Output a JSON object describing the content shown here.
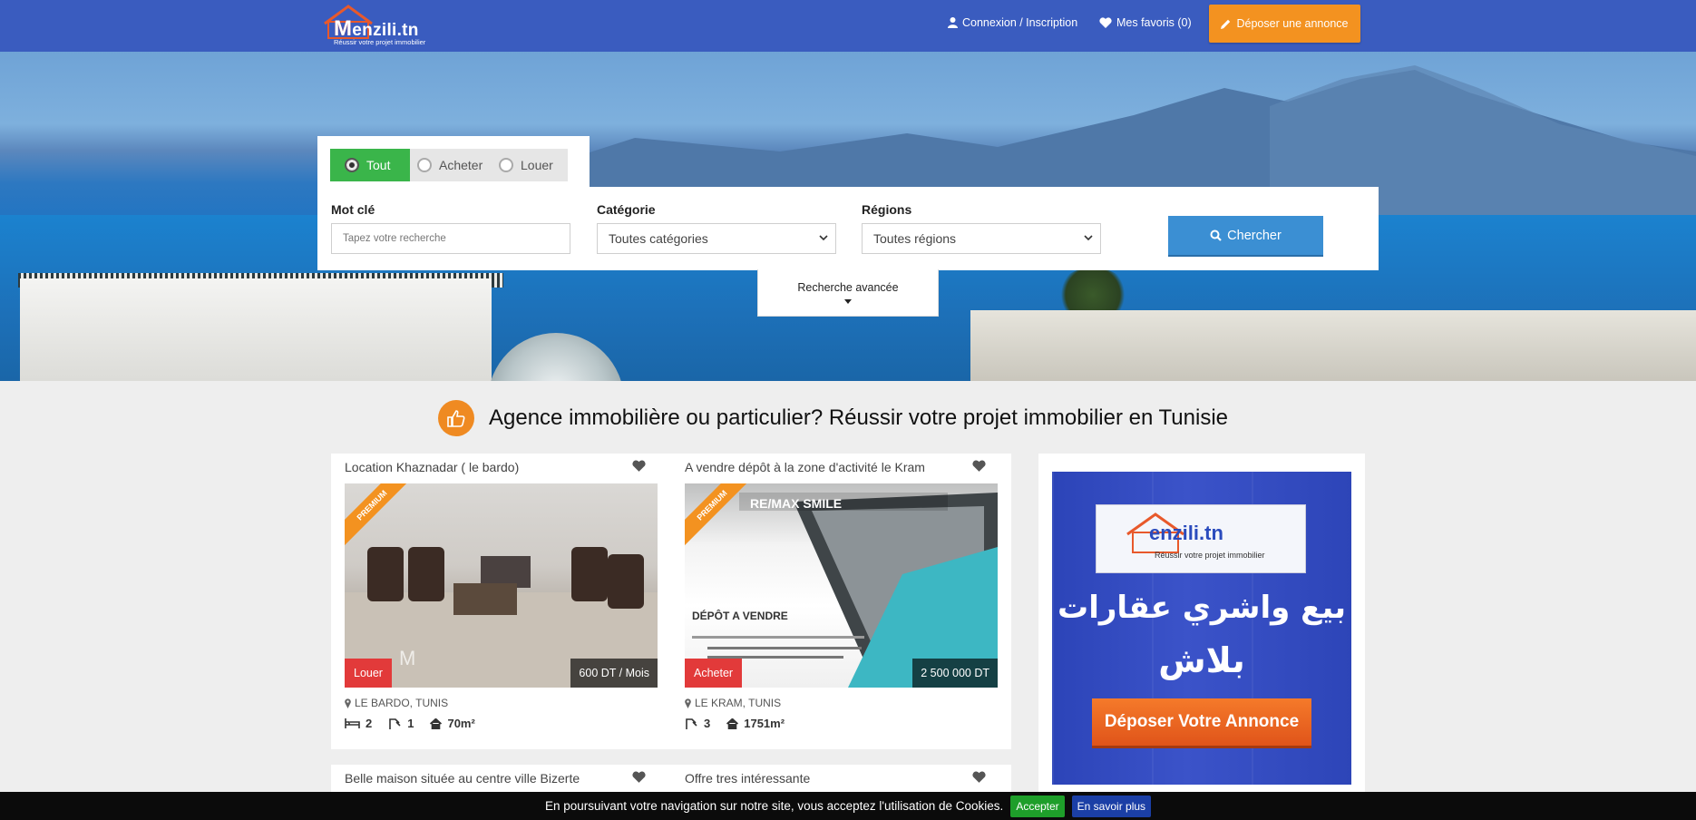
{
  "navbar": {
    "logo_brand": "enzili.tn",
    "logo_m": "M",
    "logo_tagline": "Réussir votre projet immobilier",
    "login_label": "Connexion / Inscription",
    "favorites_label": "Mes favoris (0)",
    "post_label": "Déposer une annonce"
  },
  "search": {
    "tabs": [
      {
        "label": "Tout",
        "selected": true
      },
      {
        "label": "Acheter",
        "selected": false
      },
      {
        "label": "Louer",
        "selected": false
      }
    ],
    "keyword_label": "Mot clé",
    "keyword_placeholder": "Tapez votre recherche",
    "category_label": "Catégorie",
    "category_value": "Toutes catégories",
    "region_label": "Régions",
    "region_value": "Toutes régions",
    "search_button": "Chercher",
    "advanced_label": "Recherche avancée"
  },
  "headline": "Agence immobilière ou particulier? Réussir votre projet immobilier en Tunisie",
  "listings": [
    {
      "title": "Location Khaznadar ( le bardo)",
      "ribbon": "PREMIUM",
      "type": "Louer",
      "price": "600 DT / Mois",
      "location": "LE BARDO, TUNIS",
      "bedrooms": "2",
      "bathrooms": "1",
      "surface": "70m²"
    },
    {
      "title": "A vendre dépôt à la zone d'activité le Kram",
      "ribbon": "PREMIUM",
      "type": "Acheter",
      "price": "2 500 000 DT",
      "location": "LE KRAM, TUNIS",
      "bathrooms": "3",
      "surface": "1751m²"
    },
    {
      "title": "Belle maison située au centre ville Bizerte"
    },
    {
      "title": "Offre tres intéressante"
    }
  ],
  "ad": {
    "brand": "enzili.tn",
    "tagline": "Réussir votre projet immobilier",
    "line1": "بيع واشري عقارات",
    "line2": "بلاش",
    "button": "Déposer Votre Annonce"
  },
  "cookie": {
    "message": "En poursuivant votre navigation sur notre site, vous acceptez l'utilisation de Cookies.",
    "accept": "Accepter",
    "more": "En savoir plus"
  },
  "colors": {
    "navbar": "#3a5cbf",
    "accent_orange": "#f39220",
    "active_tab": "#3ab54a",
    "search_button": "#3b8fd3",
    "badge_red": "#e23a3a"
  }
}
